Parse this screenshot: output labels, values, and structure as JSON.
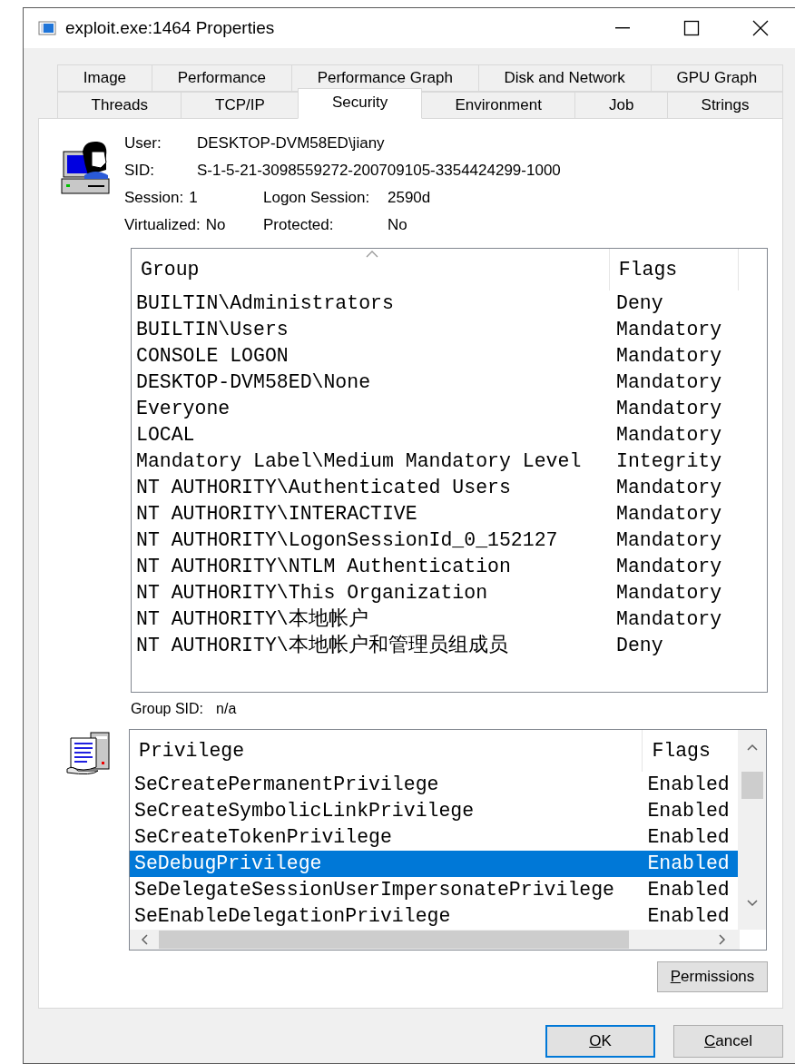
{
  "window": {
    "title": "exploit.exe:1464 Properties"
  },
  "tab_rows": [
    {
      "tabs": [
        {
          "label": "Image",
          "selected": false
        },
        {
          "label": "Performance",
          "selected": false
        },
        {
          "label": "Performance Graph",
          "selected": false
        },
        {
          "label": "Disk and Network",
          "selected": false
        },
        {
          "label": "GPU Graph",
          "selected": false
        }
      ]
    },
    {
      "tabs": [
        {
          "label": "Threads",
          "selected": false
        },
        {
          "label": "TCP/IP",
          "selected": false
        },
        {
          "label": "Security",
          "selected": true
        },
        {
          "label": "Environment",
          "selected": false
        },
        {
          "label": "Job",
          "selected": false
        },
        {
          "label": "Strings",
          "selected": false
        }
      ]
    }
  ],
  "info_rows": [
    [
      {
        "label": "User:",
        "value": "DESKTOP-DVM58ED\\jiany"
      }
    ],
    [
      {
        "label": "SID:",
        "value": "S-1-5-21-3098559272-200709105-3354424299-1000"
      }
    ],
    [
      {
        "label": "Session:",
        "value": "1"
      },
      {
        "label": "Logon Session:",
        "value": "2590d"
      }
    ],
    [
      {
        "label": "Virtualized:",
        "value": "No"
      },
      {
        "label": "Protected:",
        "value": "No"
      }
    ]
  ],
  "groups": {
    "columns": [
      {
        "label": "Group",
        "sorted": true
      },
      {
        "label": "Flags",
        "sorted": false
      }
    ],
    "rows": [
      {
        "group": "BUILTIN\\Administrators",
        "flags": "Deny"
      },
      {
        "group": "BUILTIN\\Users",
        "flags": "Mandatory"
      },
      {
        "group": "CONSOLE LOGON",
        "flags": "Mandatory"
      },
      {
        "group": "DESKTOP-DVM58ED\\None",
        "flags": "Mandatory"
      },
      {
        "group": "Everyone",
        "flags": "Mandatory"
      },
      {
        "group": "LOCAL",
        "flags": "Mandatory"
      },
      {
        "group": "Mandatory Label\\Medium Mandatory Level",
        "flags": "Integrity"
      },
      {
        "group": "NT AUTHORITY\\Authenticated Users",
        "flags": "Mandatory"
      },
      {
        "group": "NT AUTHORITY\\INTERACTIVE",
        "flags": "Mandatory"
      },
      {
        "group": "NT AUTHORITY\\LogonSessionId_0_152127",
        "flags": "Mandatory"
      },
      {
        "group": "NT AUTHORITY\\NTLM Authentication",
        "flags": "Mandatory"
      },
      {
        "group": "NT AUTHORITY\\This Organization",
        "flags": "Mandatory"
      },
      {
        "group": "NT AUTHORITY\\本地帐户",
        "flags": "Mandatory"
      },
      {
        "group": "NT AUTHORITY\\本地帐户和管理员组成员",
        "flags": "Deny"
      }
    ]
  },
  "group_sid": {
    "label": "Group SID:",
    "value": "n/a"
  },
  "privileges": {
    "columns": [
      {
        "label": "Privilege"
      },
      {
        "label": "Flags"
      }
    ],
    "rows": [
      {
        "privilege": "SeCreatePermanentPrivilege",
        "flags": "Enabled",
        "selected": false
      },
      {
        "privilege": "SeCreateSymbolicLinkPrivilege",
        "flags": "Enabled",
        "selected": false
      },
      {
        "privilege": "SeCreateTokenPrivilege",
        "flags": "Enabled",
        "selected": false
      },
      {
        "privilege": "SeDebugPrivilege",
        "flags": "Enabled",
        "selected": true
      },
      {
        "privilege": "SeDelegateSessionUserImpersonatePrivilege",
        "flags": "Enabled",
        "selected": false
      },
      {
        "privilege": "SeEnableDelegationPrivilege",
        "flags": "Enabled",
        "selected": false
      }
    ]
  },
  "permissions_button": {
    "label": "Permissions"
  },
  "dialog_buttons": [
    {
      "label": "OK",
      "default": true
    },
    {
      "label": "Cancel",
      "default": false
    }
  ]
}
